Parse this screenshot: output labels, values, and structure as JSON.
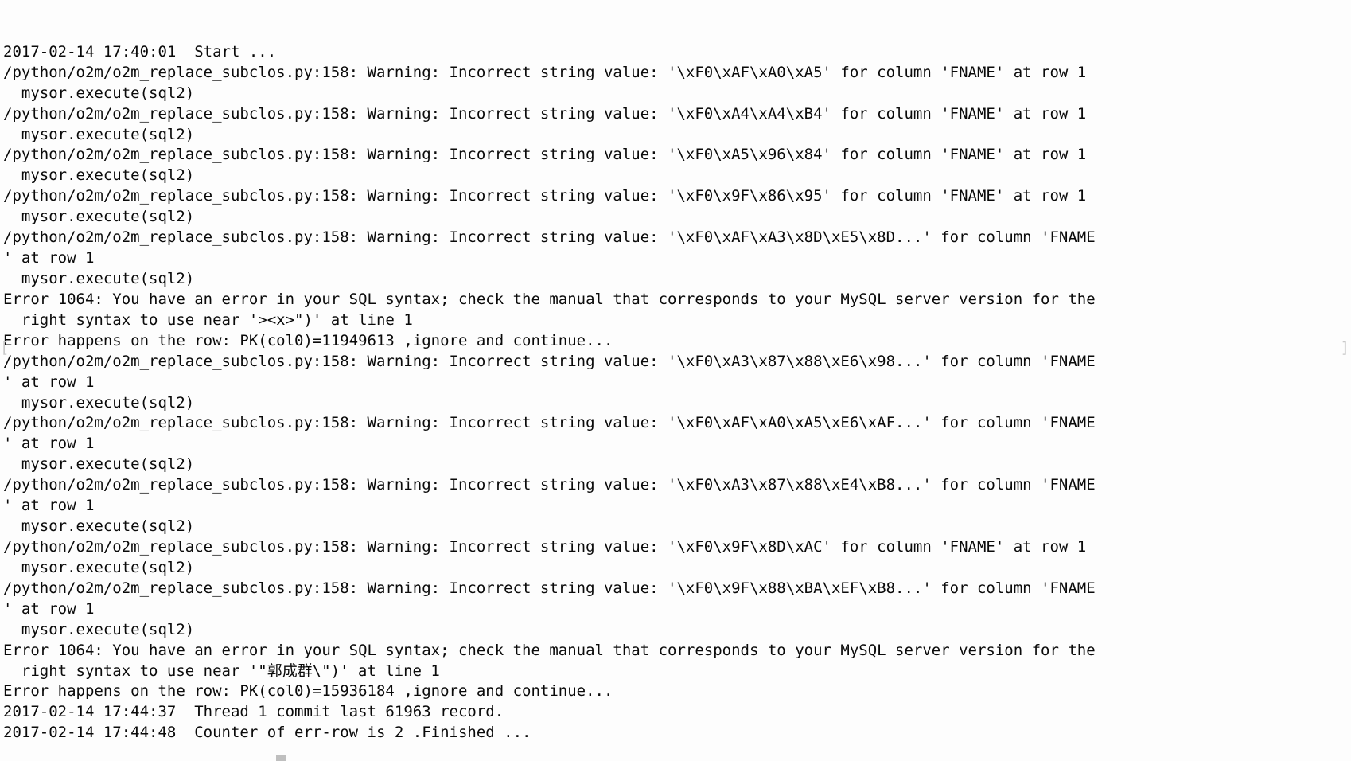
{
  "terminal": {
    "background_color": "#fdfdfd",
    "text_color": "#0a0a0a",
    "marker_color": "#c9c9c9",
    "columns": 147,
    "markers": {
      "left_bracket": "[",
      "right_bracket": "]"
    },
    "script_path": "/python/o2m/o2m_replace_subclos.py",
    "script_line": "158",
    "column_name": "FNAME",
    "start_timestamp": "2017-02-14 17:40:01",
    "commit_timestamp": "2017-02-14 17:44:37",
    "finish_timestamp": "2017-02-14 17:44:48",
    "error_code": "1064",
    "error_rows": [
      "11949613",
      "15936184"
    ],
    "committed_records": "61963",
    "err_row_count": "2",
    "lines": [
      "2017-02-14 17:40:01  Start ...",
      "/python/o2m/o2m_replace_subclos.py:158: Warning: Incorrect string value: '\\xF0\\xAF\\xA0\\xA5' for column 'FNAME' at row 1",
      "  mysor.execute(sql2)",
      "/python/o2m/o2m_replace_subclos.py:158: Warning: Incorrect string value: '\\xF0\\xA4\\xA4\\xB4' for column 'FNAME' at row 1",
      "  mysor.execute(sql2)",
      "/python/o2m/o2m_replace_subclos.py:158: Warning: Incorrect string value: '\\xF0\\xA5\\x96\\x84' for column 'FNAME' at row 1",
      "  mysor.execute(sql2)",
      "/python/o2m/o2m_replace_subclos.py:158: Warning: Incorrect string value: '\\xF0\\x9F\\x86\\x95' for column 'FNAME' at row 1",
      "  mysor.execute(sql2)",
      "/python/o2m/o2m_replace_subclos.py:158: Warning: Incorrect string value: '\\xF0\\xAF\\xA3\\x8D\\xE5\\x8D...' for column 'FNAME",
      "' at row 1",
      "  mysor.execute(sql2)",
      "Error 1064: You have an error in your SQL syntax; check the manual that corresponds to your MySQL server version for the",
      "  right syntax to use near '><x>\")' at line 1",
      "Error happens on the row: PK(col0)=11949613 ,ignore and continue...",
      "/python/o2m/o2m_replace_subclos.py:158: Warning: Incorrect string value: '\\xF0\\xA3\\x87\\x88\\xE6\\x98...' for column 'FNAME",
      "' at row 1",
      "  mysor.execute(sql2)",
      "/python/o2m/o2m_replace_subclos.py:158: Warning: Incorrect string value: '\\xF0\\xAF\\xA0\\xA5\\xE6\\xAF...' for column 'FNAME",
      "' at row 1",
      "  mysor.execute(sql2)",
      "/python/o2m/o2m_replace_subclos.py:158: Warning: Incorrect string value: '\\xF0\\xA3\\x87\\x88\\xE4\\xB8...' for column 'FNAME",
      "' at row 1",
      "  mysor.execute(sql2)",
      "/python/o2m/o2m_replace_subclos.py:158: Warning: Incorrect string value: '\\xF0\\x9F\\x8D\\xAC' for column 'FNAME' at row 1",
      "  mysor.execute(sql2)",
      "/python/o2m/o2m_replace_subclos.py:158: Warning: Incorrect string value: '\\xF0\\x9F\\x88\\xBA\\xEF\\xB8...' for column 'FNAME",
      "' at row 1",
      "  mysor.execute(sql2)",
      "Error 1064: You have an error in your SQL syntax; check the manual that corresponds to your MySQL server version for the",
      "  right syntax to use near '\"郭成群\\\")' at line 1",
      "Error happens on the row: PK(col0)=15936184 ,ignore and continue...",
      "2017-02-14 17:44:37  Thread 1 commit last 61963 record.",
      "2017-02-14 17:44:48  Counter of err-row is 2 .Finished ..."
    ]
  }
}
